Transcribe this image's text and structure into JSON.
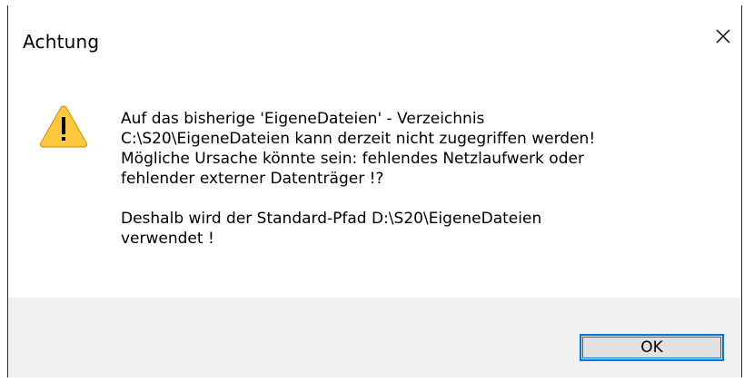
{
  "dialog": {
    "title": "Achtung",
    "icon": "warning-icon",
    "message_lines": [
      "Auf das bisherige 'EigeneDateien' - Verzeichnis\nC:\\S20\\EigeneDateien kann derzeit nicht zugegriffen werden!\nMögliche Ursache könnte sein: fehlendes Netzlaufwerk oder\nfehlender externer Datenträger !?",
      "Deshalb wird der Standard-Pfad D:\\S20\\EigeneDateien\nverwendet !"
    ],
    "ok_label": "OK"
  },
  "colors": {
    "accent": "#0078d7",
    "warning_fill": "#ffc83d",
    "footer_bg": "#f0f0f0"
  }
}
